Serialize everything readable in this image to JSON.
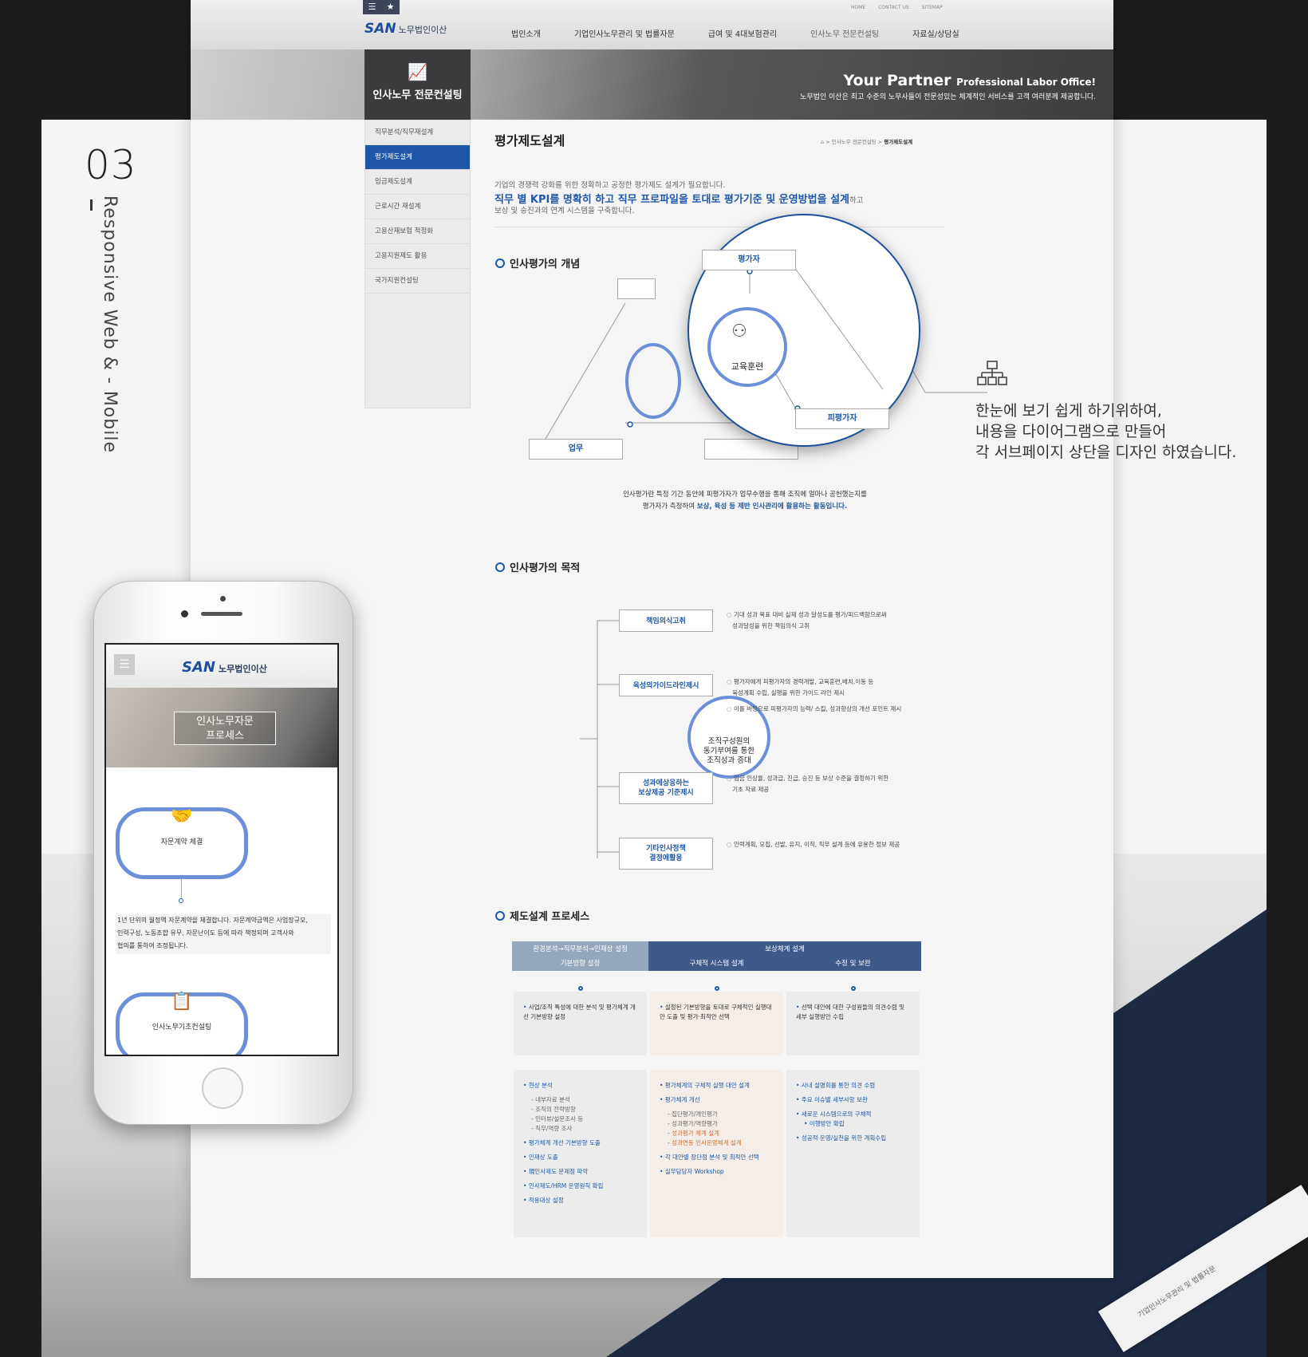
{
  "section": {
    "number": "03",
    "title": "Responsive Web & - Mobile"
  },
  "site": {
    "util_links": [
      "HOME",
      "CONTACT US",
      "SITEMAP"
    ],
    "logo": {
      "mark": "SAN",
      "name": "노무법인이산"
    },
    "gnb": [
      "법인소개",
      "기업인사노무관리 및 법률자문",
      "급여 및 4대보험관리",
      "인사노무 전문컨설팅",
      "자료실/상담실"
    ],
    "visual_title": "인사노무 전문컨설팅",
    "slogan_main": "Your Partner",
    "slogan_sub": "Professional Labor Office!",
    "slogan_desc": "노무법인 이산은 최고 수준의 노무사들이 전문성있는 체계적인 서비스를 고객 여러분께 제공합니다.",
    "lnb": [
      "직무분석/직무재설계",
      "평가제도설계",
      "임금제도설계",
      "근로시간 재설계",
      "고용산재보험 적정화",
      "고용지원제도 활용",
      "국가지원컨설팅"
    ],
    "page_title": "평가제도설계",
    "breadcrumb": [
      "인사노무 전문컨설팅",
      "평가제도설계"
    ],
    "intro": {
      "line1": "기업의 경쟁력 강화를 위한 정확하고 공정한 평가제도 설계가 필요합니다.",
      "line2": "직무 별 KPI를 명확히 하고 직무 프로파일을 토대로 평가기준 및 운영방법을 설계",
      "line2_tail": "하고",
      "line3": "보상 및 승진과의 연계 시스템을 구축합니다."
    },
    "concept": {
      "heading": "인사평가의 개념",
      "nodes": {
        "top": "평가자",
        "left": "업무",
        "right": "피평가자",
        "center": "교육훈련"
      },
      "desc1": "인사평가란 특정 기간 동안에 피평가자가 업무수행을 통해 조직에 얼마나 공헌했는지를",
      "desc2_pre": "평가자가 측정하여 ",
      "desc2_hl": "보상, 육성 등 제반 인사관리에 활용하는 활동입니다."
    },
    "purpose": {
      "heading": "인사평가의 목적",
      "center": [
        "조직구성원의",
        "동기부여를 통한",
        "조직성과 증대"
      ],
      "items": [
        {
          "label": "책임의식고취",
          "desc": [
            "기대 성과 목표 대비 실제 성과 달성도를 평가/피드백함으로써",
            "성과달성을 위한 책임의식 고취"
          ]
        },
        {
          "label": "육성의가이드라인제시",
          "desc": [
            "평가자에게 피평가자의 경력개발, 교육훈련,배치,이동 등",
            "육성계획 수립, 실행을 위한 가이드 라인 제시"
          ],
          "desc2": "이를 바탕으로 피평가자의 능력/ 스킬, 성과향상의 개선 포인트 제시"
        },
        {
          "label": [
            "성과에상응하는",
            "보상제공 기준제시"
          ],
          "desc": [
            "임금 인상율, 성과급, 진급, 승진 등 보상 수준을 결정하기 위한",
            "기초 자료 제공"
          ]
        },
        {
          "label": [
            "기타인사정책",
            "결정에활용"
          ],
          "desc": [
            "인력계획, 모집, 선발, 유지, 이직, 직무 설계 등에 유용한 정보 제공"
          ]
        }
      ]
    },
    "process": {
      "heading": "제도설계 프로세스",
      "top_left": "환경분석→직무분석→인재상 설정",
      "top_right": "보상체계 설계",
      "steps": [
        "기본방향 설정",
        "구체적 시스템 설계",
        "수정 및 보완"
      ],
      "row1": [
        "사업/조직 특성에 대한 분석 및 평가체계 개선 기본방향 설정",
        "설정된 기본방향을 토대로 구체적인 실행대안 도출 및 평가·최적안 선택",
        "선택 대안에 대한 구성원들의 의견수렴 및 세부 실행방안 수립"
      ],
      "col1": [
        "현상 분석",
        "내부자료 분석",
        "조직의 전략방향",
        "인터뷰/설문조사 등",
        "직무/역량 조사",
        "평가체계 개선 기본방향 도출",
        "인재상 도출",
        "現인사제도 문제점 파악",
        "인사제도/HRM 운영원칙 확립",
        "적용대상 설정"
      ],
      "col2": [
        "평가체계의 구체적 실행 대안 설계",
        "평가체계 개선",
        "집단평가/개인평가",
        "성과평가/역량평가",
        "성과평가 체계 설계",
        "성과연동 인사운영체계 설계",
        "각 대안별 장단점 분석 및 최적안 선택",
        "실무담당자 Workshop"
      ],
      "col3": [
        "사내 설명회를 통한 의견 수렴",
        "주요 이슈별 세부사항 보완",
        "새로운 시스템으로의 구체적",
        "이행방안 확립",
        "성공적 운영/실천을 위한 계획수립"
      ]
    }
  },
  "annotation": {
    "lines": [
      "한눈에 보기 쉽게 하기위하여,",
      "내용을 다이어그램으로 만들어",
      "각 서브페이지 상단을 디자인 하였습니다."
    ]
  },
  "mobile": {
    "logo_mark": "SAN",
    "logo_name": "노무법인이산",
    "visual_lines": [
      "인사노무자문",
      "프로세스"
    ],
    "step1": "자문계약 체결",
    "desc": [
      "1년 단위의 월정액 자문계약을 체결합니다. 자문계약금액은 사업장규모,",
      "인력구성, 노동조합 유무, 자문난이도 등에 따라 책정되며 고객사와",
      "협의를 통하여 조정됩니다."
    ],
    "step2": "인사노무기초컨설팅"
  },
  "paper_caption": "기업인사노무관리 및 법률자문",
  "colors": {
    "primary": "#1d57a6",
    "navy": "#1d2a44",
    "ring": "#6b8fd8"
  }
}
